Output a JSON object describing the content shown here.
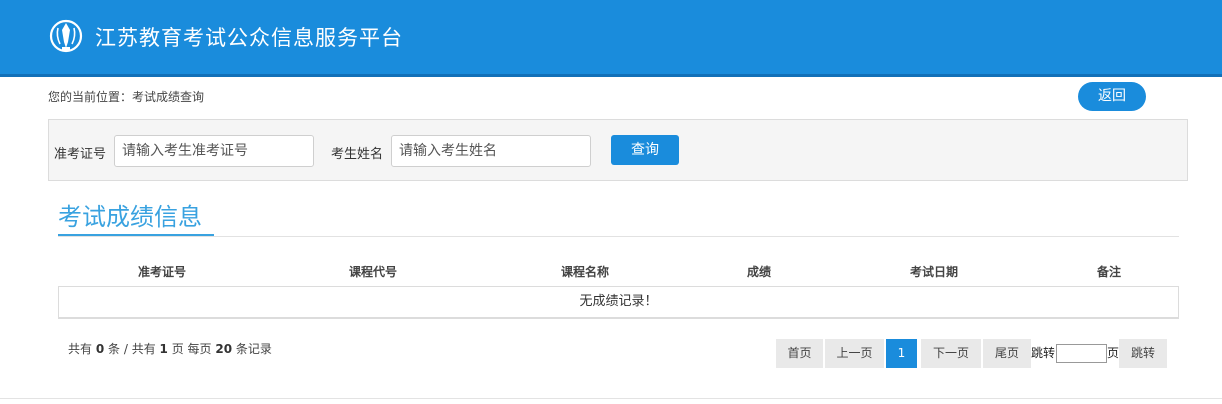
{
  "header": {
    "site_title": "江苏教育考试公众信息服务平台",
    "logo_icon": "exam-authority-emblem-icon"
  },
  "breadcrumb": {
    "prefix": "您的当前位置：",
    "current": "考试成绩查询"
  },
  "back_button": {
    "label": "返回"
  },
  "search": {
    "ticket_label": "准考证号",
    "ticket_placeholder": "请输入考生准考证号",
    "name_label": "考生姓名",
    "name_placeholder": "请输入考生姓名",
    "query_label": "查询"
  },
  "section": {
    "title": "考试成绩信息"
  },
  "table": {
    "columns": [
      "准考证号",
      "课程代号",
      "课程名称",
      "成绩",
      "考试日期",
      "备注"
    ],
    "rows": [],
    "empty_message": "无成绩记录！"
  },
  "summary": {
    "prefix": "共有",
    "total_records": "0",
    "records_unit": "条 / 共有",
    "total_pages": "1",
    "pages_unit": "页 每页",
    "page_size": "20",
    "page_size_unit": "条记录"
  },
  "pagination": {
    "first": "首页",
    "prev": "上一页",
    "current_page": "1",
    "next": "下一页",
    "last": "尾页",
    "jump_label": "跳转",
    "jump_value": "",
    "page_unit": "页",
    "jump_button": "跳转"
  },
  "colors": {
    "brand_blue": "#1a8cdc",
    "title_blue": "#39a2e0"
  }
}
